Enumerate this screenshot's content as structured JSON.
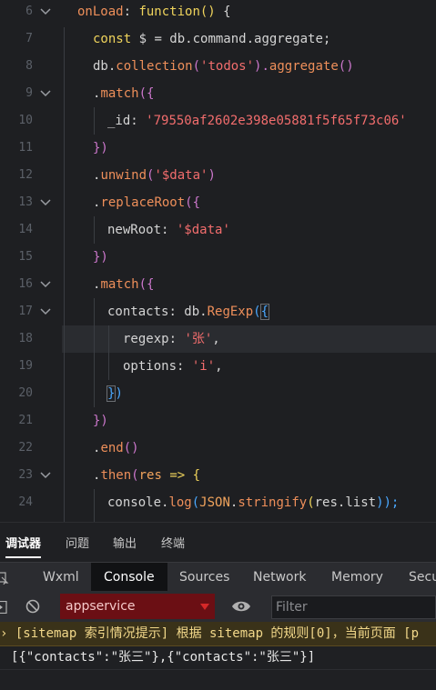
{
  "editor": {
    "lines": [
      {
        "num": "6"
      },
      {
        "num": "7"
      },
      {
        "num": "8"
      },
      {
        "num": "9"
      },
      {
        "num": "10"
      },
      {
        "num": "11"
      },
      {
        "num": "12"
      },
      {
        "num": "13"
      },
      {
        "num": "14"
      },
      {
        "num": "15"
      },
      {
        "num": "16"
      },
      {
        "num": "17"
      },
      {
        "num": "18"
      },
      {
        "num": "19"
      },
      {
        "num": "20"
      },
      {
        "num": "21"
      },
      {
        "num": "22"
      },
      {
        "num": "23"
      },
      {
        "num": "24"
      }
    ],
    "tokens": {
      "l6": [
        "onLoad",
        ": ",
        "function",
        "()",
        " {"
      ],
      "l7": [
        "const",
        " $ = db.command.",
        "aggregate",
        ";"
      ],
      "l8": [
        "db.",
        "collection",
        "(",
        "'todos'",
        ").",
        "aggregate",
        "()"
      ],
      "l9": [
        ".",
        "match",
        "({"
      ],
      "l10": [
        "_id",
        ": ",
        "'79550af2602e398e05881f5f65f73c06'"
      ],
      "l11": [
        "})"
      ],
      "l12": [
        ".",
        "unwind",
        "(",
        "'$data'",
        ")"
      ],
      "l13": [
        ".",
        "replaceRoot",
        "({"
      ],
      "l14": [
        "newRoot",
        ": ",
        "'$data'"
      ],
      "l15": [
        "})"
      ],
      "l16": [
        ".",
        "match",
        "({"
      ],
      "l17": [
        "contacts",
        ": db.",
        "RegExp",
        "(",
        "{"
      ],
      "l18": [
        "regexp",
        ": ",
        "'张'",
        ","
      ],
      "l19": [
        "options",
        ": ",
        "'i'",
        ","
      ],
      "l20": [
        "}",
        ")"
      ],
      "l21": [
        "})"
      ],
      "l22": [
        ".",
        "end",
        "()"
      ],
      "l23": [
        ".",
        "then",
        "(",
        "res",
        " => {"
      ],
      "l24": [
        "console.",
        "log",
        "(",
        "JSON",
        ".",
        "stringify",
        "(",
        "res.list",
        "));"
      ]
    }
  },
  "panel": {
    "top_tabs": [
      "调试器",
      "问题",
      "输出",
      "终端"
    ],
    "devtools_tabs": [
      "Wxml",
      "Console",
      "Sources",
      "Network",
      "Memory",
      "Secu"
    ],
    "context_select": "appservice",
    "filter_placeholder": "Filter",
    "warning_text": "› [sitemap 索引情况提示] 根据 sitemap 的规则[0]，当前页面 [p",
    "log_text": "[{\"contacts\":\"张三\"},{\"contacts\":\"张三\"}]"
  },
  "colors": {
    "background": "#1e1f22",
    "keyword": "#f0d45c",
    "function": "#ee8f5a",
    "string": "#f26d6d",
    "context_bg": "#6b0f14",
    "warning_bg": "#3a3219"
  }
}
